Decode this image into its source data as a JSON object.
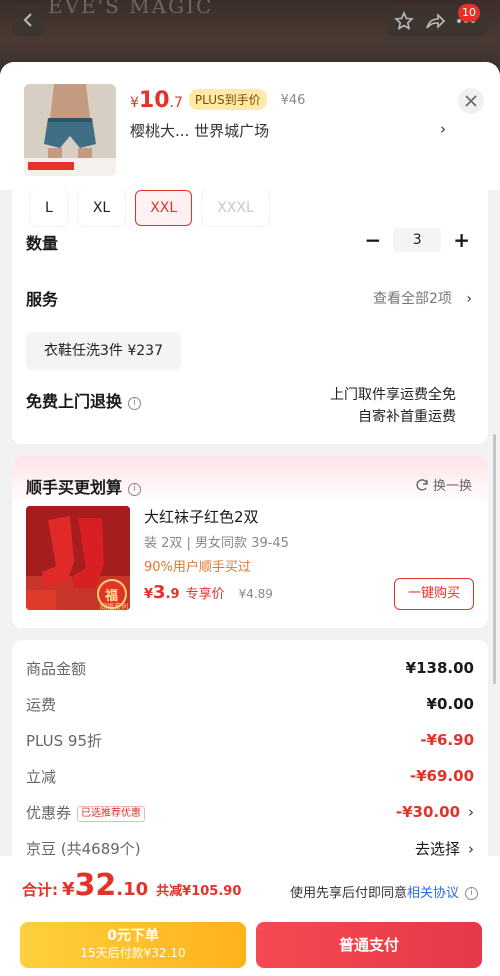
{
  "background": {
    "brand": "EVE'S MAGIC",
    "badge_count": "10",
    "icons": [
      "back-icon",
      "star-icon",
      "share-icon",
      "more-icon"
    ]
  },
  "product": {
    "price_symbol": "¥",
    "price_int": "10",
    "price_dec": ".7",
    "plus_tag": "PLUS到手价",
    "orig_price": "¥46",
    "shop": "樱桃大...  世界城广场",
    "shop_arrow": "›"
  },
  "sizes": [
    {
      "label": "L",
      "state": "normal"
    },
    {
      "label": "XL",
      "state": "normal"
    },
    {
      "label": "XXL",
      "state": "selected"
    },
    {
      "label": "XXXL",
      "state": "disabled"
    }
  ],
  "quantity": {
    "label": "数量",
    "value": "3",
    "minus": "−",
    "plus": "+"
  },
  "service": {
    "label": "服务",
    "more": "查看全部2项",
    "chip": "衣鞋任洗3件   ¥237"
  },
  "returns": {
    "label": "免费上门退换",
    "note_line1": "上门取件享运费全免",
    "note_line2": "自寄补首重运费"
  },
  "combo": {
    "title": "顺手买更划算",
    "swap": "换一换",
    "item_name": "大红袜子红色2双",
    "item_spec": "装 2双  |  男女同款 39-45",
    "popularity": "90%用户顺手买过",
    "price_symbol": "¥",
    "price_int": "3",
    "price_dec": ".9",
    "price_tag": "专享价",
    "old_price": "¥4.89",
    "buy_button": "一键购买",
    "image_badge": "福",
    "image_caption": "同福系列"
  },
  "summary": [
    {
      "key": "商品金额",
      "value": "¥138.00",
      "red": false
    },
    {
      "key": "运费",
      "value": "¥0.00",
      "red": false
    },
    {
      "key": "PLUS 95折",
      "value": "-¥6.90",
      "red": true
    },
    {
      "key": "立减",
      "value": "-¥69.00",
      "red": true
    },
    {
      "key": "优惠券",
      "tag": "已选推荐优惠",
      "value": "-¥30.00",
      "red": true,
      "chevron": "›"
    },
    {
      "key": "京豆 (共4689个)",
      "value": "去选择",
      "red": false,
      "chevron": "›"
    }
  ],
  "footer": {
    "total_label": "合计:",
    "total_symbol": "¥",
    "total_int": "32",
    "total_dec": ".10",
    "saved": "共减¥105.90",
    "agree_text": "使用先享后付即同意",
    "agree_link": "相关协议",
    "pay_later_line1": "0元下单",
    "pay_later_line2": "15天后付款¥32.10",
    "pay_button": "普通支付"
  },
  "colors": {
    "accent": "#e4322a",
    "gold": "#ffb21c",
    "link": "#2d6be0"
  }
}
